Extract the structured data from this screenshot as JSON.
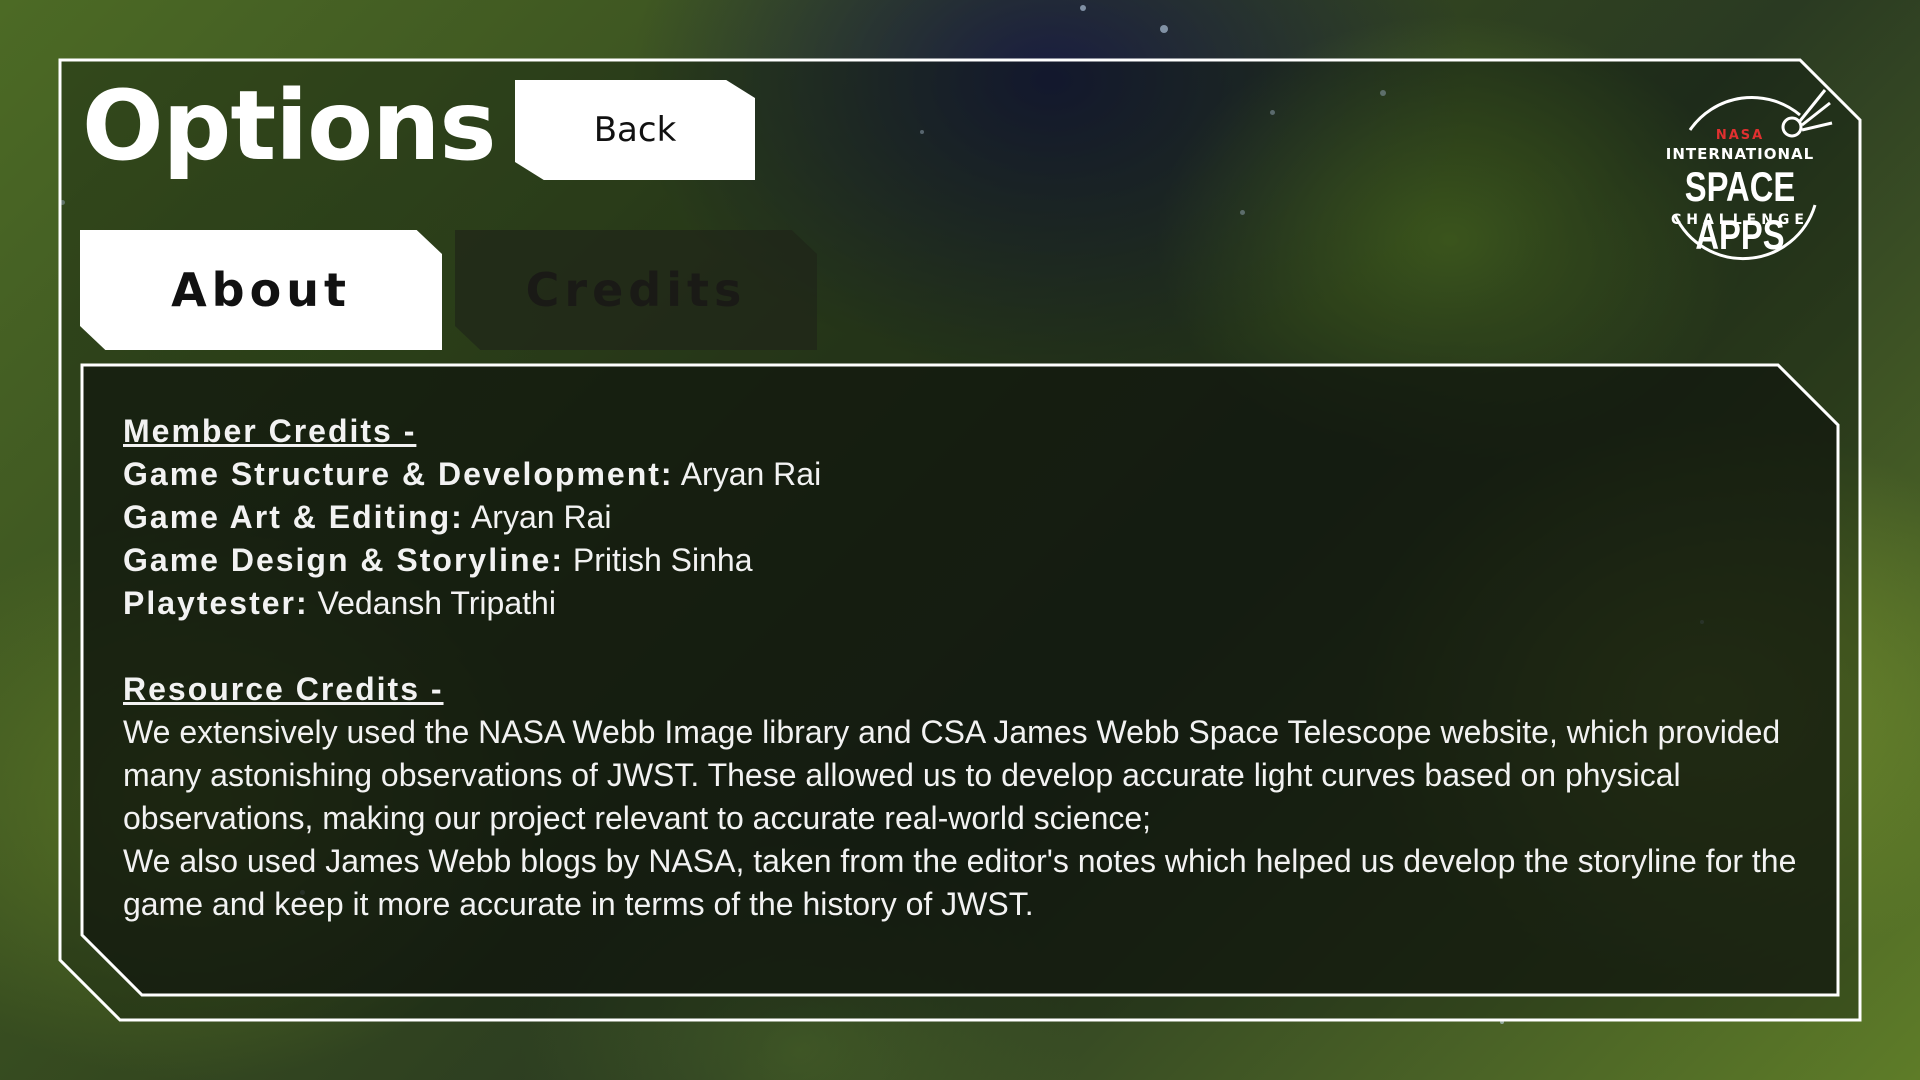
{
  "title": "Options",
  "back_label": "Back",
  "tabs": [
    {
      "label": "About",
      "active": true
    },
    {
      "label": "Credits",
      "active": false
    }
  ],
  "logo": {
    "nasa": "NASA",
    "line1": "INTERNATIONAL",
    "line2": "SPACE APPS",
    "line3": "CHALLENGE"
  },
  "member_credits": {
    "heading": "Member Credits -",
    "rows": [
      {
        "role": "Game Structure & Development:",
        "name": "Aryan Rai"
      },
      {
        "role": "Game Art & Editing:",
        "name": "Aryan Rai"
      },
      {
        "role": "Game Design & Storyline:",
        "name": "Pritish Sinha"
      },
      {
        "role": "Playtester:",
        "name": "Vedansh Tripathi"
      }
    ]
  },
  "resource_credits": {
    "heading": "Resource Credits -",
    "para1": "We extensively used the NASA Webb Image library and CSA James Webb Space Telescope website, which provided many astonishing observations of JWST. These allowed us to develop accurate light curves based on physical observations, making our project relevant to accurate real-world science;",
    "para2": "We also used James Webb blogs by NASA, taken from the editor's notes which helped us develop the storyline for the game and keep it more accurate in terms of the history of JWST."
  },
  "colors": {
    "panel_bg": "#182014",
    "accent_red": "#e03030",
    "frame": "#ffffff"
  },
  "icons": [
    "space-apps-logo"
  ]
}
